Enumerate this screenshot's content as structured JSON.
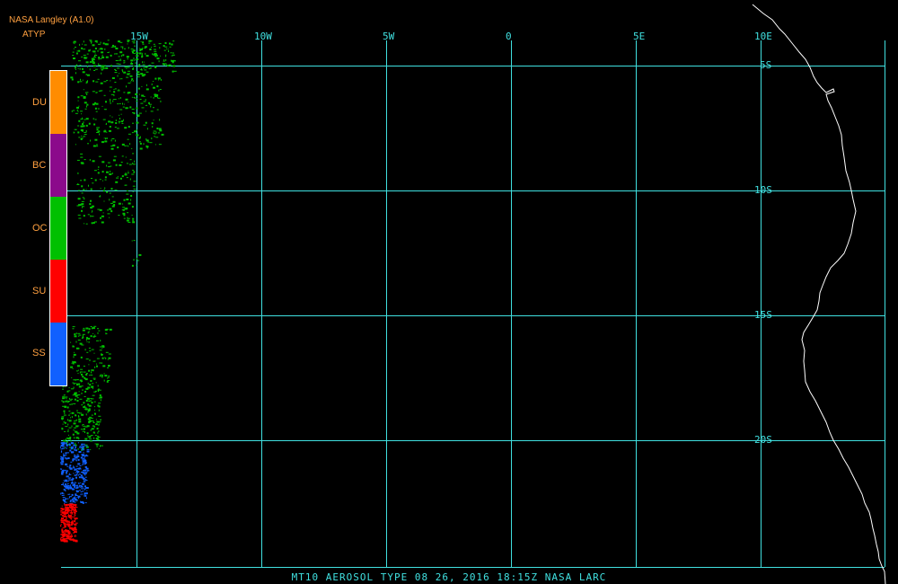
{
  "header": {
    "organization": "NASA Langley (A1.0)",
    "product": "ATYP"
  },
  "legend": {
    "classes": [
      {
        "code": "DU",
        "color": "#ff8c00"
      },
      {
        "code": "BC",
        "color": "#8b0a8b"
      },
      {
        "code": "OC",
        "color": "#00c000"
      },
      {
        "code": "SU",
        "color": "#ff0000"
      },
      {
        "code": "SS",
        "color": "#1060ff"
      }
    ]
  },
  "grid": {
    "longitude_labels": [
      "15W",
      "10W",
      "5W",
      "0",
      "5E",
      "10E"
    ],
    "latitude_labels": [
      "5S",
      "10S",
      "15S",
      "20S"
    ],
    "line_color": "#40e0e0"
  },
  "coastline_color": "#ffffff",
  "footer": {
    "caption": "MT10  AEROSOL TYPE   08 26, 2016 18:15Z   NASA LARC"
  }
}
